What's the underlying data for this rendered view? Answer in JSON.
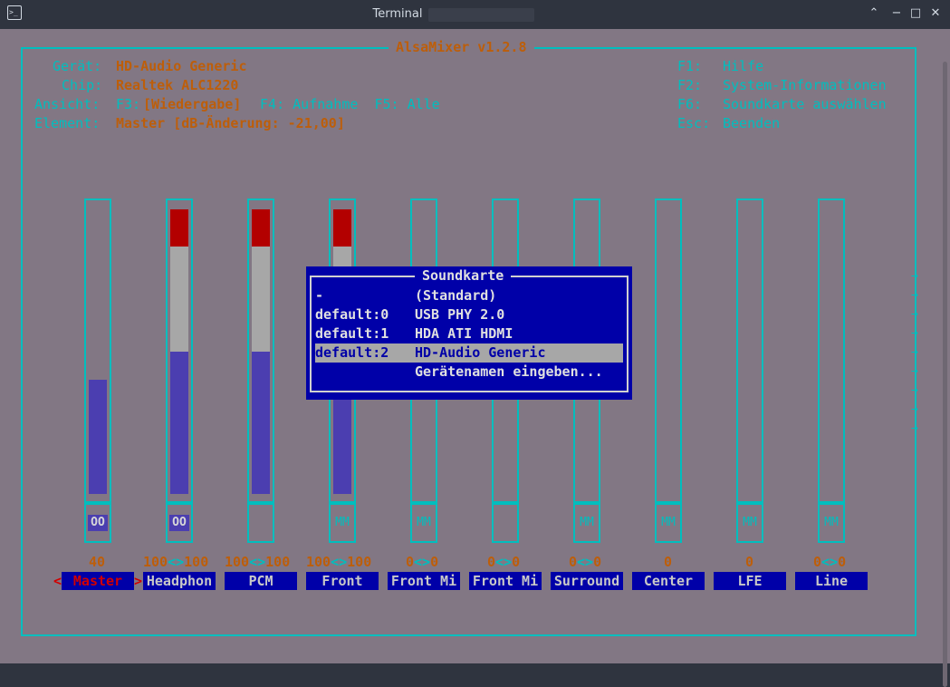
{
  "window": {
    "title": "Terminal",
    "icon": "terminal-icon",
    "app_icon_glyph": ">_",
    "controls": {
      "up": "⌃",
      "minimize": "−",
      "maximize": "□",
      "close": "✕"
    }
  },
  "header": {
    "title": "AlsaMixer v1.2.8",
    "info": [
      {
        "label": "Gerät:",
        "value": "HD-Audio Generic"
      },
      {
        "label": "Chip:",
        "value": "Realtek ALC1220"
      },
      {
        "label": "Ansicht:",
        "value_cyan_pre": "F3:",
        "value": "[Wiedergabe]",
        "value_cyan_post": " F4: Aufnahme  F5: Alle"
      },
      {
        "label": "Element:",
        "value": "Master [dB-Änderung: -21,00]"
      }
    ],
    "keys": [
      {
        "key": "F1:",
        "desc": "Hilfe"
      },
      {
        "key": "F2:",
        "desc": "System-Informationen"
      },
      {
        "key": "F6:",
        "desc": "Soundkarte auswählen"
      },
      {
        "key": "Esc:",
        "desc": "Beenden"
      }
    ]
  },
  "channels": [
    {
      "name": "Master",
      "volume": "40",
      "left": null,
      "right": null,
      "mute": "OO",
      "level": 40,
      "selected": true
    },
    {
      "name": "Headphon",
      "volume": "",
      "left": "100",
      "right": "100",
      "mute": "OO",
      "level": 100,
      "selected": false
    },
    {
      "name": "PCM",
      "volume": "",
      "left": "100",
      "right": "100",
      "mute": "",
      "level": 100,
      "selected": false
    },
    {
      "name": "Front",
      "volume": "",
      "left": "100",
      "right": "100",
      "mute": "MM",
      "level": 100,
      "selected": false
    },
    {
      "name": "Front Mi",
      "volume": "",
      "left": "0",
      "right": "0",
      "mute": "MM",
      "level": 0,
      "selected": false
    },
    {
      "name": "Front Mi",
      "volume": "",
      "left": "0",
      "right": "0",
      "mute": "",
      "level": 0,
      "selected": false
    },
    {
      "name": "Surround",
      "volume": "",
      "left": "0",
      "right": "0",
      "mute": "MM",
      "level": 0,
      "selected": false
    },
    {
      "name": "Center",
      "volume": "0",
      "left": null,
      "right": null,
      "mute": "MM",
      "level": 0,
      "selected": false
    },
    {
      "name": "LFE",
      "volume": "0",
      "left": null,
      "right": null,
      "mute": "MM",
      "level": 0,
      "selected": false
    },
    {
      "name": "Line",
      "volume": "",
      "left": "0",
      "right": "0",
      "mute": "MM",
      "level": 0,
      "selected": false
    }
  ],
  "stereo_arrows": "<>",
  "selection_markers": {
    "left": "<",
    "right": ">"
  },
  "scroll_arrow": "→",
  "dialog": {
    "title": "Soundkarte",
    "items": [
      {
        "key": "-",
        "value": "(Standard)",
        "selected": false
      },
      {
        "key": "default:0",
        "value": "USB PHY 2.0",
        "selected": false
      },
      {
        "key": "default:1",
        "value": "HDA ATI HDMI",
        "selected": false
      },
      {
        "key": "default:2",
        "value": "HD-Audio Generic",
        "selected": true
      },
      {
        "key": "",
        "value": "Gerätenamen eingeben...",
        "selected": false
      }
    ]
  },
  "colors": {
    "background": "#827784",
    "frame": "#00bebe",
    "highlight_text": "#bd5e0a",
    "dialog_bg": "#0000a8",
    "bar_blue": "#4b3eb0",
    "bar_red": "#b30000",
    "bar_grey": "#a7a7a7"
  }
}
